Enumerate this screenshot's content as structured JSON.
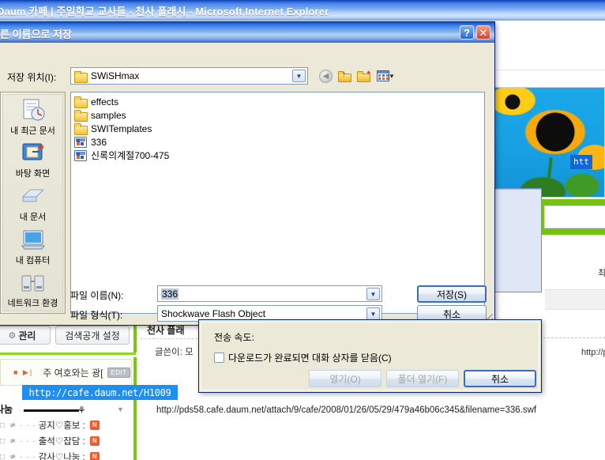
{
  "browser": {
    "title": "Daum 카페 | 주일학교 교사들 - 천사 플래시 - Microsoft Internet Explorer"
  },
  "save_dialog": {
    "title": "른 이름으로 저장",
    "help_label": "?",
    "close_label": "✕",
    "lookin_label": "저장 위치(I):",
    "lookin_value": "SWiSHmax",
    "toolbar": {
      "back_icon": "back-arrow-icon",
      "up_icon": "up-one-level-icon",
      "new_folder_icon": "new-folder-icon",
      "views_icon": "views-menu-icon"
    },
    "places": [
      {
        "label": "내 최근 문서",
        "icon": "recent-documents-icon"
      },
      {
        "label": "바탕 화면",
        "icon": "desktop-icon"
      },
      {
        "label": "내 문서",
        "icon": "my-documents-icon"
      },
      {
        "label": "내 컴퓨터",
        "icon": "my-computer-icon"
      },
      {
        "label": "네트워크 환경",
        "icon": "network-places-icon"
      }
    ],
    "files": [
      {
        "name": "effects",
        "type": "folder"
      },
      {
        "name": "samples",
        "type": "folder"
      },
      {
        "name": "SWITemplates",
        "type": "folder"
      },
      {
        "name": "336",
        "type": "flash"
      },
      {
        "name": "신록의계절700-475",
        "type": "flash"
      }
    ],
    "filename_label": "파일 이름(N):",
    "filename_value": "336",
    "filetype_label": "파일 형식(T):",
    "filetype_value": "Shockwave Flash Object",
    "save_button": "저장(S)",
    "cancel_button": "취소"
  },
  "download_dialog": {
    "transfer_rate_label": "전송 속도:",
    "close_when_done_label": "다운로드가 완료되면 대화 상자를 닫음(C)",
    "close_when_done_checked": false,
    "open_button": "열기(O)",
    "open_folder_button": "폴더 열기(F)",
    "cancel_button": "취소"
  },
  "inner_window": {
    "minimize_label": "_",
    "maximize_label": "□",
    "close_label": "✕"
  },
  "cafe_page": {
    "manage_button": "관리",
    "search_setting_button": "검색공개 설정",
    "banner_text": "주 여호와는 광[",
    "banner_edit_chip": "EDIT",
    "tooltip_url": "http://cafe.daum.net/H1009",
    "divider_label": "나눔",
    "board_items": [
      {
        "text": "공지♡홍보 :",
        "badge": "N"
      },
      {
        "text": "출석♡잡담 :",
        "badge": "N"
      },
      {
        "text": "감사♡나눔 :",
        "badge": "N"
      }
    ],
    "mid_text_1": "천사 플래",
    "mid_text_2": "글쓴이: 모",
    "status_url": "http://pds58.cafe.daum.net/attach/9/cafe/2008/01/26/05/29/479a46b06c345&filename=336.swf",
    "right_url_chip": "htt",
    "right_text_1": "최",
    "right_http": "http://p"
  },
  "colors": {
    "titlebar_blue": "#2b62d4",
    "dialog_face": "#ece9d8",
    "accent_green": "#76c111",
    "link_highlight": "#1c8ff0",
    "badge_orange": "#f05a28"
  }
}
